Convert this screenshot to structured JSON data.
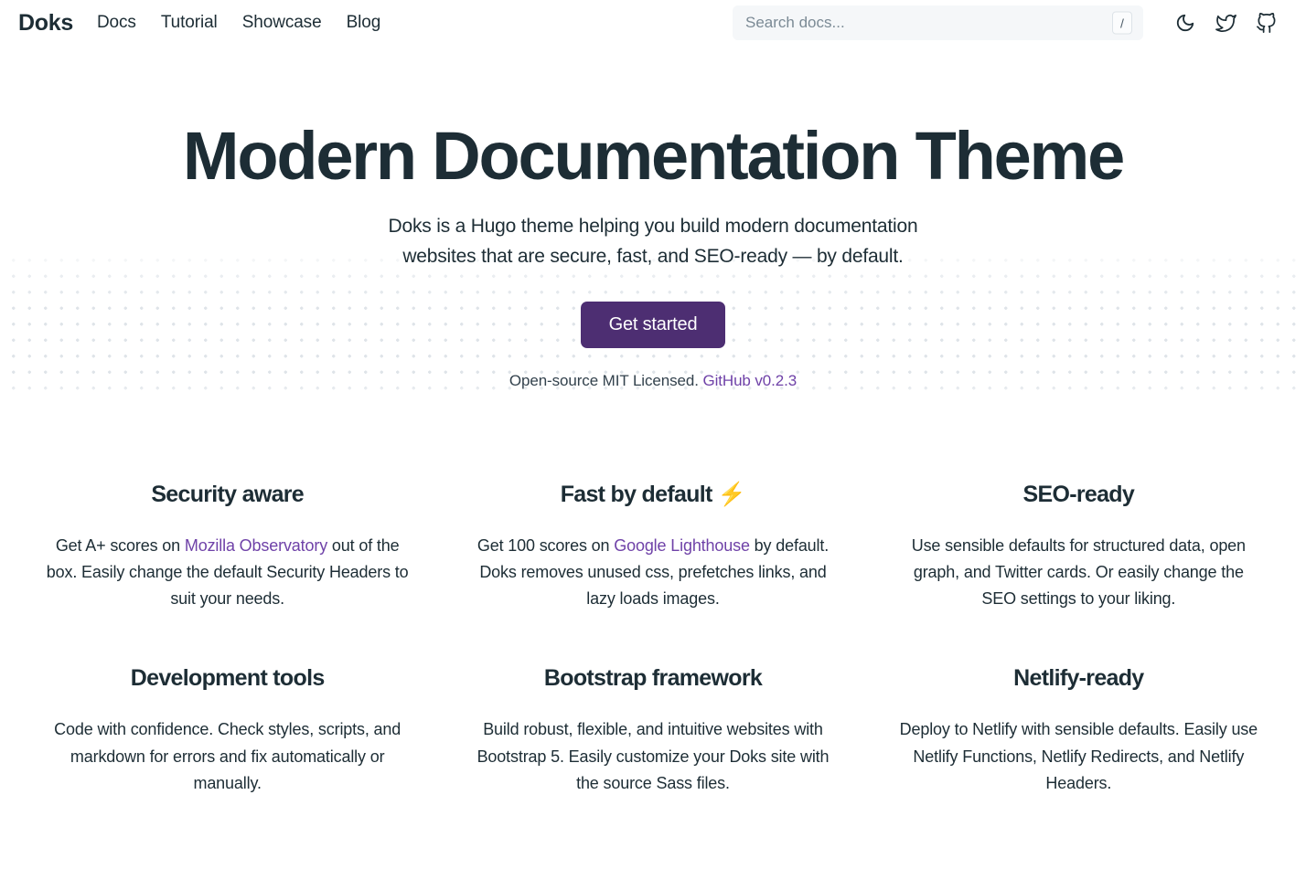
{
  "navbar": {
    "brand": "Doks",
    "links": [
      {
        "label": "Docs"
      },
      {
        "label": "Tutorial"
      },
      {
        "label": "Showcase"
      },
      {
        "label": "Blog"
      }
    ],
    "search": {
      "placeholder": "Search docs...",
      "value": "",
      "shortcut": "/"
    },
    "icons": [
      {
        "name": "moon-icon",
        "label": "Toggle dark mode"
      },
      {
        "name": "twitter-icon",
        "label": "Twitter"
      },
      {
        "name": "github-icon",
        "label": "GitHub"
      }
    ]
  },
  "hero": {
    "title": "Modern Documentation Theme",
    "lead": "Doks is a Hugo theme helping you build modern documentation websites that are secure, fast, and SEO-ready — by default.",
    "cta_label": "Get started",
    "license_prefix": "Open-source MIT Licensed.",
    "license_link": "GitHub v0.2.3"
  },
  "features": [
    {
      "title": "Security aware",
      "body_before": "Get A+ scores on ",
      "link": "Mozilla Observatory",
      "body_after": " out of the box. Easily change the default Security Headers to suit your needs."
    },
    {
      "title": "Fast by default",
      "title_emoji": "⚡",
      "body_before": "Get 100 scores on ",
      "link": "Google Lighthouse",
      "body_after": " by default. Doks removes unused css, prefetches links, and lazy loads images."
    },
    {
      "title": "SEO-ready",
      "body_before": "Use sensible defaults for structured data, open graph, and Twitter cards. Or easily change the SEO settings to your liking.",
      "link": "",
      "body_after": ""
    },
    {
      "title": "Development tools",
      "body_before": "Code with confidence. Check styles, scripts, and markdown for errors and fix automatically or manually.",
      "link": "",
      "body_after": ""
    },
    {
      "title": "Bootstrap framework",
      "body_before": "Build robust, flexible, and intuitive websites with Bootstrap 5. Easily customize your Doks site with the source Sass files.",
      "link": "",
      "body_after": ""
    },
    {
      "title": "Netlify-ready",
      "body_before": "Deploy to Netlify with sensible defaults. Easily use Netlify Functions, Netlify Redirects, and Netlify Headers.",
      "link": "",
      "body_after": ""
    }
  ],
  "colors": {
    "text": "#1d2d35",
    "accent": "#4d2e72",
    "link": "#6f42a8",
    "search_bg": "#f5f7f9",
    "dot": "#dfe4e9",
    "bolt": "#f5a623"
  }
}
